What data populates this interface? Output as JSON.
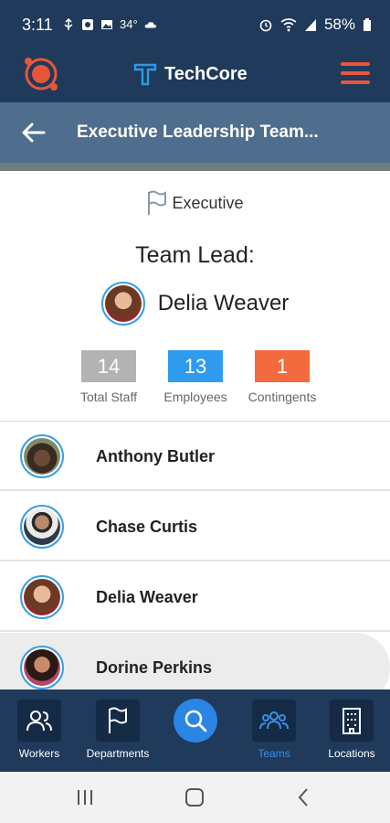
{
  "status_bar": {
    "time": "3:11",
    "temperature": "34°",
    "battery": "58%"
  },
  "header": {
    "brand": "TechCore",
    "accent_color": "#e8563a",
    "brand_blue": "#2b9be8"
  },
  "title_bar": {
    "title": "Executive Leadership Team..."
  },
  "team": {
    "category": "Executive",
    "team_lead_label": "Team Lead:",
    "team_lead_name": "Delia Weaver",
    "stats": [
      {
        "value": "14",
        "label": "Total Staff",
        "color": "#b3b3b3"
      },
      {
        "value": "13",
        "label": "Employees",
        "color": "#2f9bef"
      },
      {
        "value": "1",
        "label": "Contingents",
        "color": "#f26a3d"
      }
    ]
  },
  "members": [
    {
      "name": "Anthony Butler"
    },
    {
      "name": "Chase Curtis"
    },
    {
      "name": "Delia Weaver"
    },
    {
      "name": "Dorine Perkins"
    }
  ],
  "bottom_nav": {
    "items": [
      {
        "label": "Workers",
        "icon": "users-icon"
      },
      {
        "label": "Departments",
        "icon": "flag-icon"
      },
      {
        "label": "Teams",
        "icon": "team-icon",
        "active": true
      },
      {
        "label": "Locations",
        "icon": "building-icon"
      }
    ],
    "search_icon": "search-icon"
  }
}
